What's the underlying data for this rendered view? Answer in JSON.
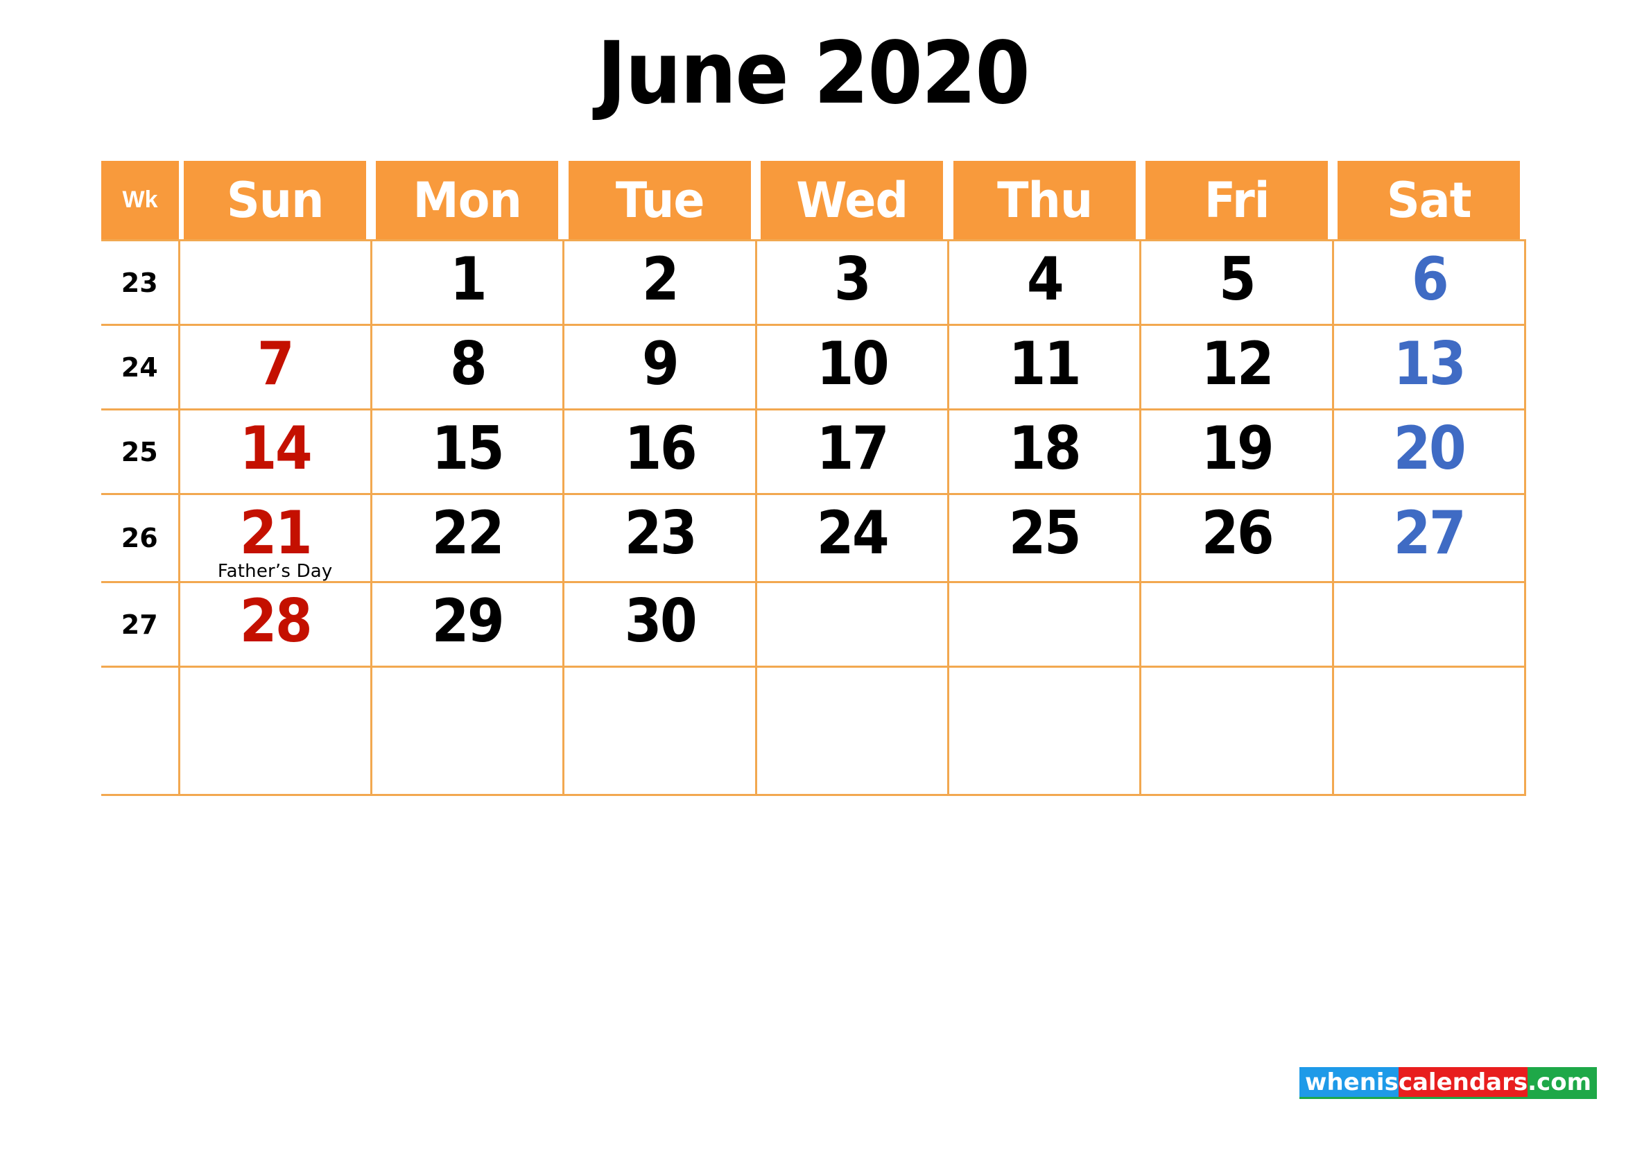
{
  "title": "June 2020",
  "colors": {
    "header_bg": "#F89A3C",
    "grid_border": "#F2A850",
    "sunday": "#C41000",
    "saturday": "#3F6BC4",
    "weekday": "#000000"
  },
  "header": {
    "week_label": "Wk",
    "days": [
      "Sun",
      "Mon",
      "Tue",
      "Wed",
      "Thu",
      "Fri",
      "Sat"
    ]
  },
  "weeks": [
    {
      "wk": "23",
      "days": [
        {
          "num": "",
          "color": "red",
          "event": ""
        },
        {
          "num": "1",
          "color": "black",
          "event": ""
        },
        {
          "num": "2",
          "color": "black",
          "event": ""
        },
        {
          "num": "3",
          "color": "black",
          "event": ""
        },
        {
          "num": "4",
          "color": "black",
          "event": ""
        },
        {
          "num": "5",
          "color": "black",
          "event": ""
        },
        {
          "num": "6",
          "color": "blue",
          "event": ""
        }
      ]
    },
    {
      "wk": "24",
      "days": [
        {
          "num": "7",
          "color": "red",
          "event": ""
        },
        {
          "num": "8",
          "color": "black",
          "event": ""
        },
        {
          "num": "9",
          "color": "black",
          "event": ""
        },
        {
          "num": "10",
          "color": "black",
          "event": ""
        },
        {
          "num": "11",
          "color": "black",
          "event": ""
        },
        {
          "num": "12",
          "color": "black",
          "event": ""
        },
        {
          "num": "13",
          "color": "blue",
          "event": ""
        }
      ]
    },
    {
      "wk": "25",
      "days": [
        {
          "num": "14",
          "color": "red",
          "event": ""
        },
        {
          "num": "15",
          "color": "black",
          "event": ""
        },
        {
          "num": "16",
          "color": "black",
          "event": ""
        },
        {
          "num": "17",
          "color": "black",
          "event": ""
        },
        {
          "num": "18",
          "color": "black",
          "event": ""
        },
        {
          "num": "19",
          "color": "black",
          "event": ""
        },
        {
          "num": "20",
          "color": "blue",
          "event": ""
        }
      ]
    },
    {
      "wk": "26",
      "days": [
        {
          "num": "21",
          "color": "red",
          "event": "Father’s Day"
        },
        {
          "num": "22",
          "color": "black",
          "event": ""
        },
        {
          "num": "23",
          "color": "black",
          "event": ""
        },
        {
          "num": "24",
          "color": "black",
          "event": ""
        },
        {
          "num": "25",
          "color": "black",
          "event": ""
        },
        {
          "num": "26",
          "color": "black",
          "event": ""
        },
        {
          "num": "27",
          "color": "blue",
          "event": ""
        }
      ]
    },
    {
      "wk": "27",
      "days": [
        {
          "num": "28",
          "color": "red",
          "event": ""
        },
        {
          "num": "29",
          "color": "black",
          "event": ""
        },
        {
          "num": "30",
          "color": "black",
          "event": ""
        },
        {
          "num": "",
          "color": "black",
          "event": ""
        },
        {
          "num": "",
          "color": "black",
          "event": ""
        },
        {
          "num": "",
          "color": "black",
          "event": ""
        },
        {
          "num": "",
          "color": "blue",
          "event": ""
        }
      ]
    },
    {
      "wk": "",
      "days": [
        {
          "num": "",
          "color": "red",
          "event": ""
        },
        {
          "num": "",
          "color": "black",
          "event": ""
        },
        {
          "num": "",
          "color": "black",
          "event": ""
        },
        {
          "num": "",
          "color": "black",
          "event": ""
        },
        {
          "num": "",
          "color": "black",
          "event": ""
        },
        {
          "num": "",
          "color": "black",
          "event": ""
        },
        {
          "num": "",
          "color": "blue",
          "event": ""
        }
      ]
    }
  ],
  "watermark": {
    "part1": "whenis",
    "part2": "calendars",
    "part3": ".com"
  }
}
